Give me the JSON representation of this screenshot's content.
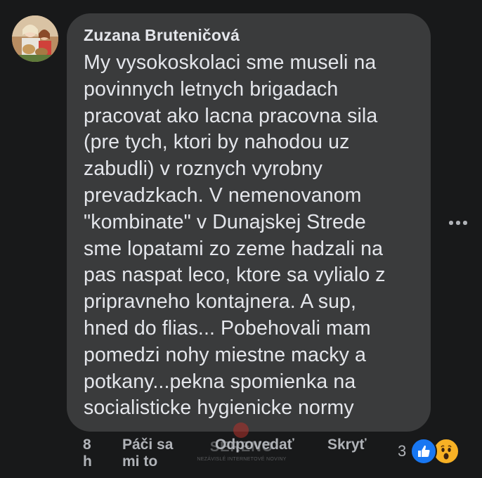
{
  "comment": {
    "author": "Zuzana Bruteničová",
    "text": "My vysokoskolaci sme museli na\npovinnych letnych brigadach\npracovat ako lacna pracovna sila\n(pre tych, ktori by nahodou uz\nzabudli) v roznych vyrobny\nprevadzkach. V nemenovanom\n\"kombinate\" v Dunajskej Strede\nsme lopatami zo zeme hadzali na\npas naspat leco, ktore sa vylialo z\npripravneho kontajnera. A sup,\nhned do flias... Pobehovali mam\npomedzi nohy miestne macky a\npotkany...pekna spomienka na\nsocialisticke hygienicke normy"
  },
  "actions": {
    "time": "8\nh",
    "like": "Páči sa\nmi to",
    "reply": "Odpovedať",
    "hide": "Skryť"
  },
  "reactions": {
    "count": "3",
    "types": [
      "like-icon",
      "wow-icon"
    ]
  },
  "watermark": {
    "name": "SERENO",
    "tagline": "NEZÁVISLÉ INTERNETOVÉ NOVINY"
  },
  "colors": {
    "background": "#18191a",
    "bubble": "#3a3b3c",
    "text": "#e4e6eb",
    "secondary": "#b0b3b8",
    "like_blue": "#1877f2",
    "wow_yellow": "#f7b125"
  }
}
